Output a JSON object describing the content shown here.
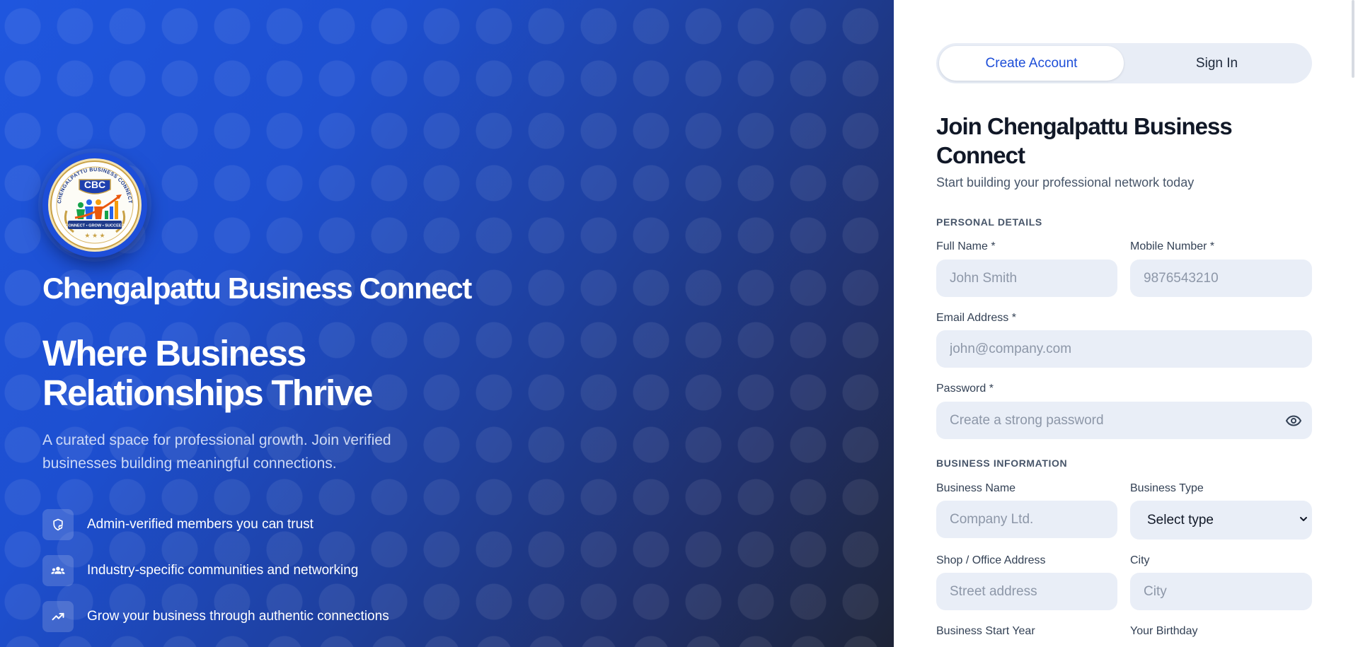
{
  "hero": {
    "logo": {
      "text": "CBC",
      "ring_text": "CHENGALPATTU BUSINESS CONNECT",
      "motto": "CONNECT • GROW • SUCCEED"
    },
    "brand_name": "Chengalpattu Business Connect",
    "tagline": "Where Business Relationships Thrive",
    "subtitle": "A curated space for professional growth. Join verified businesses building meaningful connections.",
    "features": [
      {
        "icon": "verified-shield-icon",
        "text": "Admin-verified members you can trust"
      },
      {
        "icon": "people-group-icon",
        "text": "Industry-specific communities and networking"
      },
      {
        "icon": "trending-up-icon",
        "text": "Grow your business through authentic connections"
      }
    ]
  },
  "auth_tabs": {
    "create": "Create Account",
    "signin": "Sign In",
    "active": "create"
  },
  "form": {
    "title": "Join Chengalpattu Business Connect",
    "subtitle": "Start building your professional network today",
    "personal_section": "PERSONAL DETAILS",
    "full_name": {
      "label": "Full Name *",
      "placeholder": "John Smith",
      "value": ""
    },
    "mobile": {
      "label": "Mobile Number *",
      "placeholder": "9876543210",
      "value": ""
    },
    "email": {
      "label": "Email Address *",
      "placeholder": "john@company.com",
      "value": ""
    },
    "password": {
      "label": "Password *",
      "placeholder": "Create a strong password",
      "value": "",
      "toggle_icon": "eye-icon"
    },
    "business_section": "BUSINESS INFORMATION",
    "business_name": {
      "label": "Business Name",
      "placeholder": "Company Ltd.",
      "value": ""
    },
    "business_type": {
      "label": "Business Type",
      "selected": "Select type"
    },
    "address": {
      "label": "Shop / Office Address",
      "placeholder": "Street address",
      "value": ""
    },
    "city": {
      "label": "City",
      "placeholder": "City",
      "value": ""
    },
    "start_year": {
      "label": "Business Start Year"
    },
    "birthday": {
      "label": "Your Birthday"
    }
  },
  "colors": {
    "accent": "#1d4ed8",
    "hero_gradient_start": "#1f56de",
    "hero_gradient_end": "#1e2437",
    "input_bg": "#e9eef7",
    "title_text": "#111827"
  }
}
